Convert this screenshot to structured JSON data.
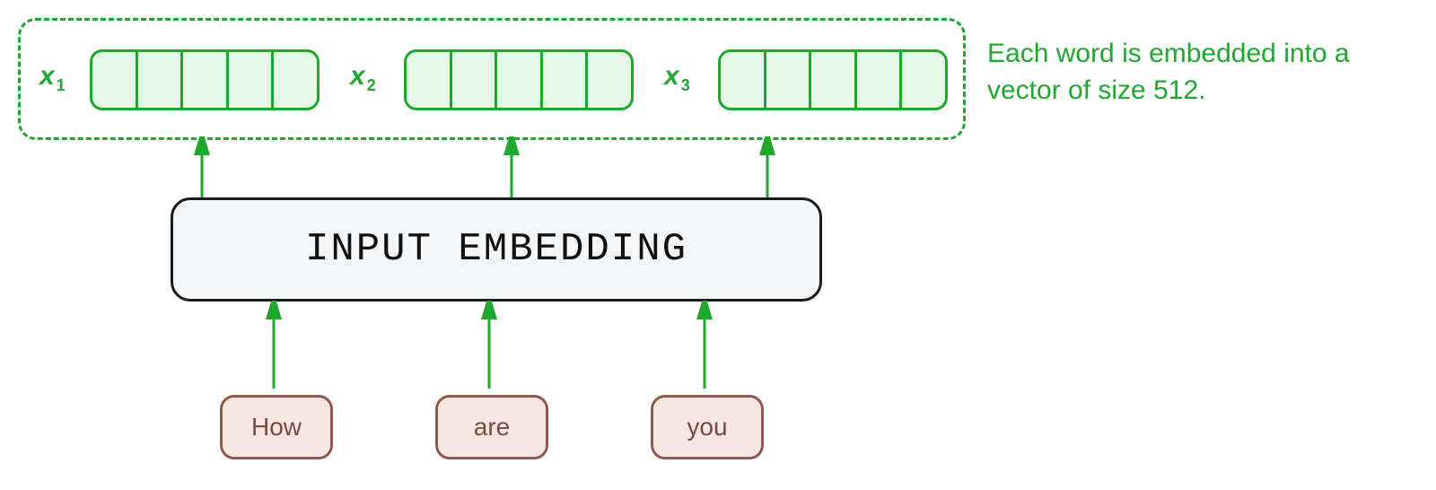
{
  "caption": "Each word is embedded into a vector of size 512.",
  "embedder_label": "INPUT EMBEDDING",
  "words": [
    "How",
    "are",
    "you"
  ],
  "vectors": [
    "x",
    "x",
    "x"
  ],
  "vector_subscripts": [
    "1",
    "2",
    "3"
  ],
  "colors": {
    "green": "#1fa82e",
    "green_fill": "#e5f7e6",
    "box_bg": "#f4f6f8",
    "word_bg": "#f6e7e2",
    "word_border": "#8c5a4f"
  }
}
